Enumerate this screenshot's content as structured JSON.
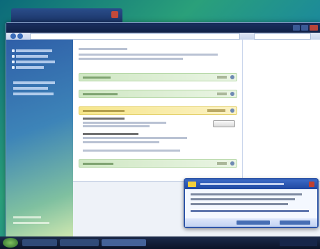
{
  "window": {
    "title": "",
    "search_placeholder": ""
  },
  "sidebar": {
    "items": [
      {
        "label": ""
      },
      {
        "label": ""
      },
      {
        "label": ""
      },
      {
        "label": ""
      },
      {
        "label": ""
      }
    ]
  },
  "main": {
    "categories": [
      {
        "label": "",
        "status": "",
        "color": "green"
      },
      {
        "label": "",
        "status": "",
        "color": "green"
      },
      {
        "label": "",
        "status": "",
        "color": "yellow"
      },
      {
        "label": "",
        "status": "",
        "color": "green"
      }
    ],
    "button_label": ""
  },
  "balloon": {
    "title": "",
    "body": "",
    "buttons": [
      {
        "label": ""
      },
      {
        "label": ""
      }
    ]
  },
  "colors": {
    "accent": "#2f56a8",
    "warning": "#f6e58a",
    "ok": "#cfe7c3"
  },
  "icons": {
    "start": "start-orb-icon",
    "shield": "security-shield-icon",
    "back": "back-arrow-icon",
    "forward": "forward-arrow-icon",
    "close": "close-icon"
  }
}
